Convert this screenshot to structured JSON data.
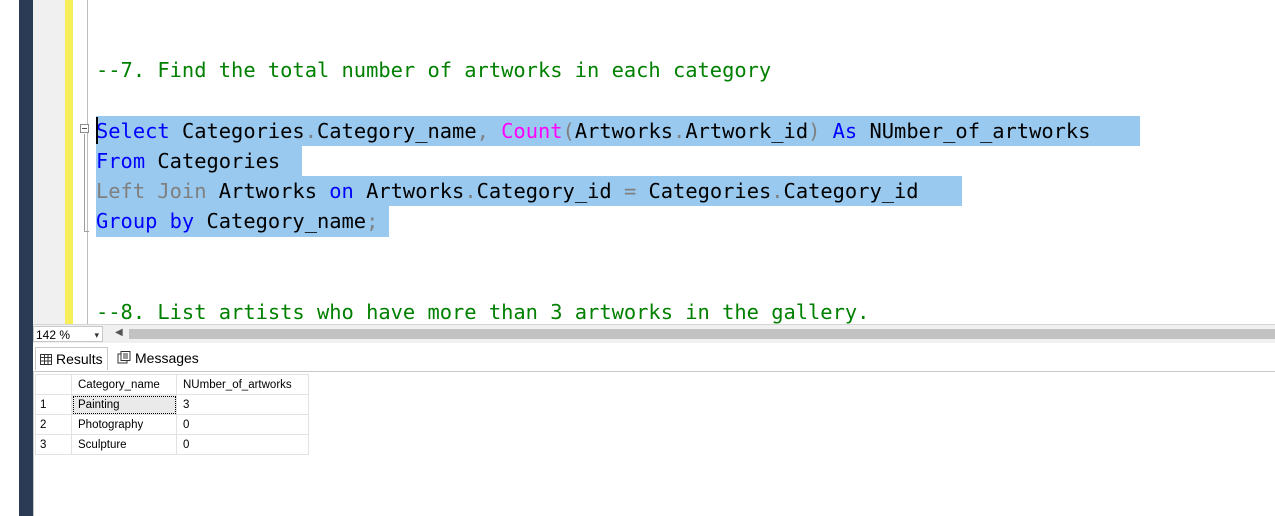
{
  "editor": {
    "comment7": "--7. Find the total number of artworks in each category",
    "line1": {
      "kw_select": "Select",
      "t1": " Categories",
      "dot1": ".",
      "t2": "Category_name",
      "comma": ",",
      "t3": " ",
      "fn_count": "Count",
      "paren_open": "(",
      "t4": "Artworks",
      "dot2": ".",
      "t5": "Artwork_id",
      "paren_close": ")",
      "t6": " ",
      "kw_as": "As",
      "t7": " NUmber_of_artworks"
    },
    "line2": {
      "kw_from": "From",
      "t1": " Categories "
    },
    "line3": {
      "kw_left_join": "Left Join",
      "t1": " Artworks ",
      "kw_on": "on",
      "t2": " Artworks",
      "dot1": ".",
      "t3": "Category_id ",
      "eq": "=",
      "t4": " Categories",
      "dot2": ".",
      "t5": "Category_id "
    },
    "line4": {
      "kw_group_by": "Group by",
      "t1": " Category_name",
      "semicolon": ";"
    },
    "comment8": "--8. List artists who have more than 3 artworks in the gallery."
  },
  "zoom": {
    "level": "142 %",
    "arrow": "▾",
    "scroll_left": "◀"
  },
  "tabs": {
    "results_label": "Results",
    "messages_label": "Messages"
  },
  "grid": {
    "columns": [
      "Category_name",
      "NUmber_of_artworks"
    ],
    "rows": [
      {
        "num": "1",
        "category": "Painting",
        "count": "3"
      },
      {
        "num": "2",
        "category": "Photography",
        "count": "0"
      },
      {
        "num": "3",
        "category": "Sculpture",
        "count": "0"
      }
    ]
  },
  "colors": {
    "keyword": "#0000ff",
    "function": "#ff00ff",
    "comment": "#008000",
    "operator_gray": "#808080",
    "selection": "#99c9ef"
  }
}
